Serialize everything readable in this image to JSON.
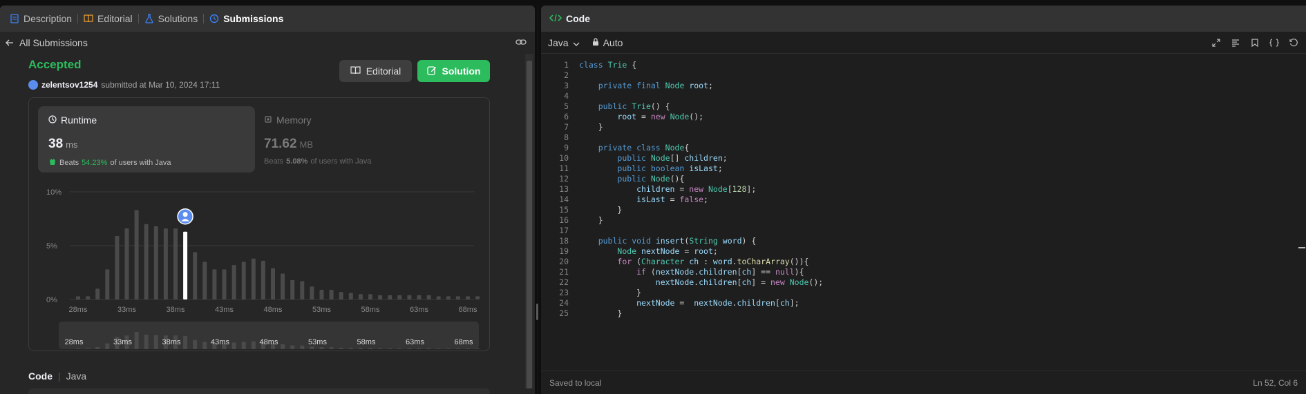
{
  "tabs": [
    {
      "label": "Description",
      "icon": "description-icon"
    },
    {
      "label": "Editorial",
      "icon": "book-icon"
    },
    {
      "label": "Solutions",
      "icon": "flask-icon"
    },
    {
      "label": "Submissions",
      "icon": "history-icon",
      "active": true
    }
  ],
  "back": {
    "label": "All Submissions"
  },
  "submission": {
    "status": "Accepted",
    "user": "zelentsov1254",
    "submitted_text": "submitted at Mar 10, 2024 17:11",
    "editorial_button": "Editorial",
    "solution_button": "Solution"
  },
  "runtime": {
    "title": "Runtime",
    "value": "38",
    "unit": "ms",
    "beats_label": "Beats",
    "beats_pct": "54.23%",
    "beats_suffix": "of users with Java"
  },
  "memory": {
    "title": "Memory",
    "value": "71.62",
    "unit": "MB",
    "beats_label": "Beats",
    "beats_pct": "5.08%",
    "beats_suffix": "of users with Java"
  },
  "chart_data": {
    "type": "bar",
    "yticks": [
      "10%",
      "5%",
      "0%"
    ],
    "ylim": [
      0,
      10
    ],
    "x_tick_labels": [
      "28ms",
      "33ms",
      "38ms",
      "43ms",
      "48ms",
      "53ms",
      "58ms",
      "63ms",
      "68ms"
    ],
    "values": [
      0.3,
      0.3,
      1.0,
      2.8,
      5.9,
      6.6,
      8.3,
      7.0,
      6.8,
      6.6,
      6.6,
      6.3,
      4.4,
      3.5,
      2.8,
      2.8,
      3.2,
      3.5,
      3.8,
      3.6,
      2.9,
      2.4,
      1.8,
      1.7,
      1.2,
      0.9,
      0.9,
      0.7,
      0.6,
      0.5,
      0.5,
      0.4,
      0.4,
      0.4,
      0.4,
      0.4,
      0.4,
      0.3,
      0.3,
      0.3,
      0.3,
      0.3
    ],
    "highlight_index": 11,
    "colors": {
      "bar": "#4a4a4a",
      "highlight": "#ffffff",
      "grid": "#3a3a3a"
    }
  },
  "code_section": {
    "label": "Code",
    "lang": "Java"
  },
  "right": {
    "title": "Code",
    "language": "Java",
    "mode": "Auto",
    "status_left": "Saved to local",
    "status_right": "Ln 52, Col 6"
  },
  "code_lines": [
    "class Trie {",
    "",
    "    private final Node root;",
    "",
    "    public Trie() {",
    "        root = new Node();",
    "    }",
    "",
    "    private class Node{",
    "        public Node[] children;",
    "        public boolean isLast;",
    "        public Node(){",
    "            children = new Node[128];",
    "            isLast = false;",
    "        }",
    "    }",
    "",
    "    public void insert(String word) {",
    "        Node nextNode = root;",
    "        for (Character ch : word.toCharArray()){",
    "            if (nextNode.children[ch] == null){",
    "                nextNode.children[ch] = new Node();",
    "            }",
    "            nextNode =  nextNode.children[ch];",
    "        }"
  ]
}
